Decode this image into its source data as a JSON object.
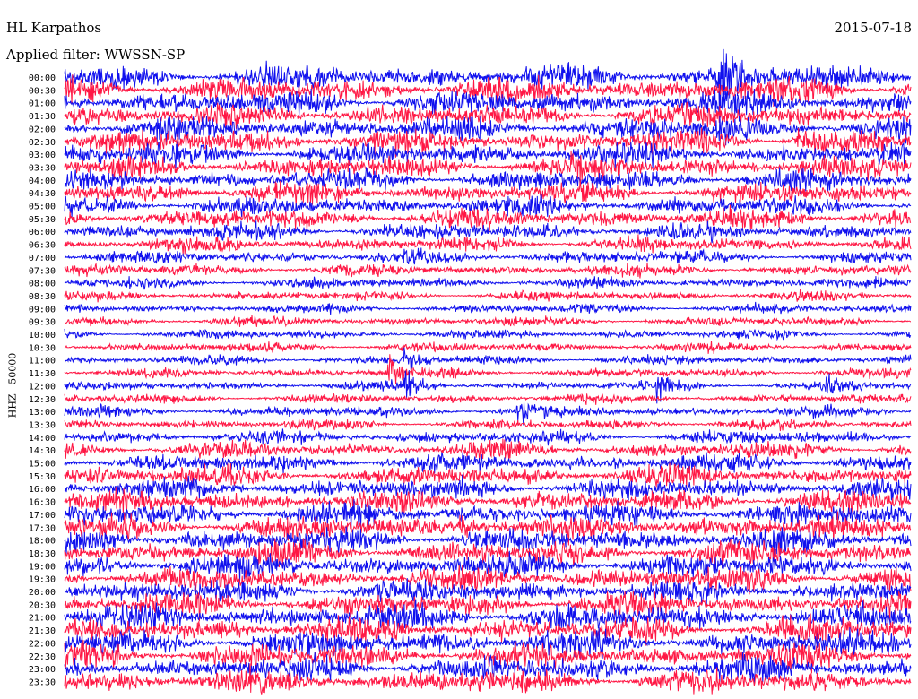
{
  "header": {
    "station": "HL Karpathos",
    "date": "2015-07-18",
    "filter_label": "Applied filter: WWSSN-SP",
    "channel_label": "HHZ - 50000"
  },
  "colors": {
    "trace_a": "#1010ee",
    "trace_b": "#ff1744"
  },
  "chart_data": {
    "type": "line",
    "title": "HL Karpathos",
    "subtitle": "Applied filter: WWSSN-SP",
    "ylabel": "HHZ - 50000",
    "y_tick_labels": [
      "00:00",
      "00:30",
      "01:00",
      "01:30",
      "02:00",
      "02:30",
      "03:00",
      "03:30",
      "04:00",
      "04:30",
      "05:00",
      "05:30",
      "06:00",
      "06:30",
      "07:00",
      "07:30",
      "08:00",
      "08:30",
      "09:00",
      "09:30",
      "10:00",
      "10:30",
      "11:00",
      "11:30",
      "12:00",
      "12:30",
      "13:00",
      "13:30",
      "14:00",
      "14:30",
      "15:00",
      "15:30",
      "16:00",
      "16:30",
      "17:00",
      "17:30",
      "18:00",
      "18:30",
      "19:00",
      "19:30",
      "20:00",
      "20:30",
      "21:00",
      "21:30",
      "22:00",
      "22:30",
      "23:00",
      "23:30"
    ],
    "row_amplitude": [
      1.9,
      1.9,
      1.9,
      1.8,
      1.8,
      1.8,
      1.7,
      1.7,
      1.6,
      1.6,
      1.5,
      1.5,
      1.3,
      1.1,
      1.0,
      0.9,
      0.8,
      0.7,
      0.7,
      0.7,
      0.7,
      0.7,
      0.7,
      0.7,
      0.7,
      0.7,
      0.8,
      0.8,
      1.0,
      1.2,
      1.4,
      1.5,
      1.6,
      1.7,
      1.7,
      1.8,
      1.8,
      1.8,
      1.8,
      1.8,
      1.8,
      1.8,
      1.9,
      1.9,
      1.9,
      1.9,
      1.9,
      1.9
    ],
    "events": [
      {
        "row": 0,
        "minute": 23.2,
        "amplitude": 6
      },
      {
        "row": 4,
        "minute": 23.2,
        "amplitude": 3
      },
      {
        "row": 5,
        "minute": 26.0,
        "amplitude": 2
      },
      {
        "row": 22,
        "minute": 12.0,
        "amplitude": 3
      },
      {
        "row": 23,
        "minute": 11.5,
        "amplitude": 3
      },
      {
        "row": 24,
        "minute": 12.0,
        "amplitude": 2.5
      },
      {
        "row": 24,
        "minute": 21.0,
        "amplitude": 2
      },
      {
        "row": 24,
        "minute": 27.0,
        "amplitude": 2
      },
      {
        "row": 26,
        "minute": 16.0,
        "amplitude": 2
      },
      {
        "row": 35,
        "minute": 14.0,
        "amplitude": 2
      }
    ],
    "x_range_minutes": [
      0,
      30
    ],
    "grid": false,
    "series": [
      {
        "color": "#1010ee"
      },
      {
        "color": "#ff1744"
      }
    ]
  }
}
